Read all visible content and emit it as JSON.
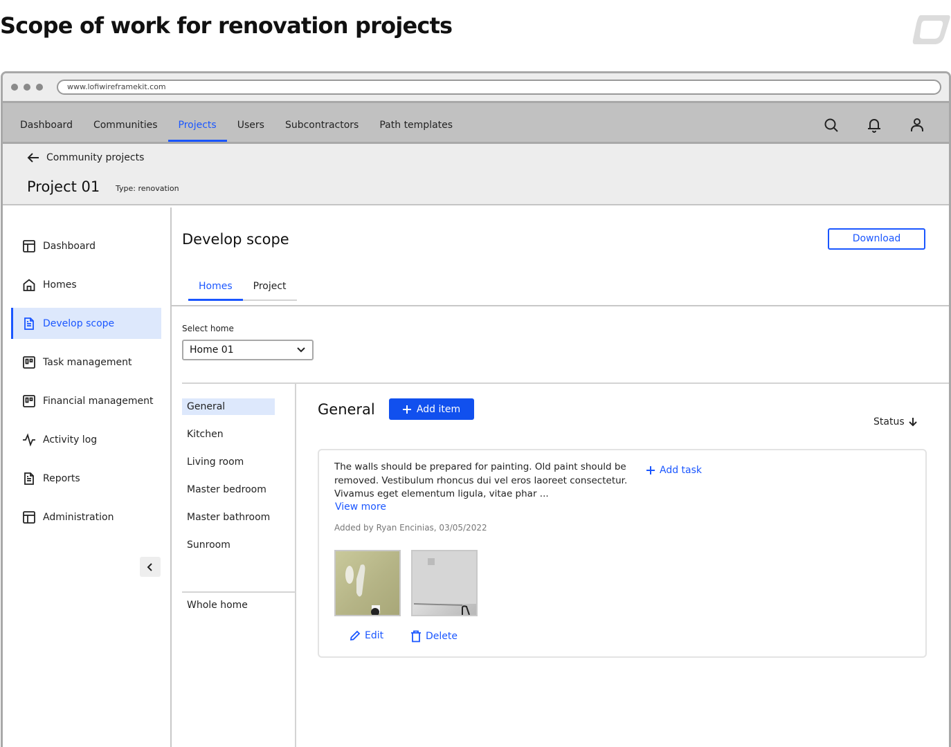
{
  "page": {
    "title": "Scope of work for renovation projects"
  },
  "browser": {
    "url": "www.lofiwireframekit.com"
  },
  "topnav": {
    "items": [
      {
        "label": "Dashboard",
        "active": false
      },
      {
        "label": "Communities",
        "active": false
      },
      {
        "label": "Projects",
        "active": true
      },
      {
        "label": "Users",
        "active": false
      },
      {
        "label": "Subcontractors",
        "active": false
      },
      {
        "label": "Path templates",
        "active": false
      }
    ],
    "icons": [
      "search-icon",
      "bell-icon",
      "user-icon"
    ]
  },
  "subheader": {
    "back_label": "Community projects",
    "project_title": "Project 01",
    "project_type": "Type: renovation"
  },
  "sidebar": {
    "items": [
      {
        "label": "Dashboard",
        "icon": "layout-icon",
        "active": false
      },
      {
        "label": "Homes",
        "icon": "home-icon",
        "active": false
      },
      {
        "label": "Develop scope",
        "icon": "document-icon",
        "active": true
      },
      {
        "label": "Task management",
        "icon": "kanban-icon",
        "active": false
      },
      {
        "label": "Financial management",
        "icon": "kanban-icon",
        "active": false
      },
      {
        "label": "Activity log",
        "icon": "activity-icon",
        "active": false
      },
      {
        "label": "Reports",
        "icon": "document-icon",
        "active": false
      },
      {
        "label": "Administration",
        "icon": "layout-icon",
        "active": false
      }
    ],
    "collapse_icon": "chevron-left-icon"
  },
  "main": {
    "title": "Develop scope",
    "download_label": "Download",
    "tabs": [
      {
        "label": "Homes",
        "active": true
      },
      {
        "label": "Project",
        "active": false
      }
    ],
    "select_home": {
      "label": "Select home",
      "value": "Home 01"
    },
    "rooms": [
      {
        "label": "General",
        "active": true
      },
      {
        "label": "Kitchen",
        "active": false
      },
      {
        "label": "Living room",
        "active": false
      },
      {
        "label": "Master bedroom",
        "active": false
      },
      {
        "label": "Master bathroom",
        "active": false
      },
      {
        "label": "Sunroom",
        "active": false
      }
    ],
    "whole_home_label": "Whole home",
    "section": {
      "title": "General",
      "add_item_label": "Add item",
      "status_sort_label": "Status"
    },
    "card": {
      "description": "The walls should be prepared for painting. Old paint should be removed. Vestibulum rhoncus dui vel eros laoreet consectetur. Vivamus eget elementum ligula, vitae phar ...",
      "view_more_label": "View more",
      "meta": "Added by Ryan Encinias, 03/05/2022",
      "add_task_label": "Add task",
      "images": [
        "wall-patched-photo",
        "room-walls-photo"
      ],
      "edit_label": "Edit",
      "delete_label": "Delete"
    }
  },
  "colors": {
    "accent": "#1a56ff",
    "primary_button": "#1150ee",
    "active_bg": "#dde8fc",
    "nav_bg": "#c1c1c1",
    "subheader_bg": "#ededed"
  }
}
